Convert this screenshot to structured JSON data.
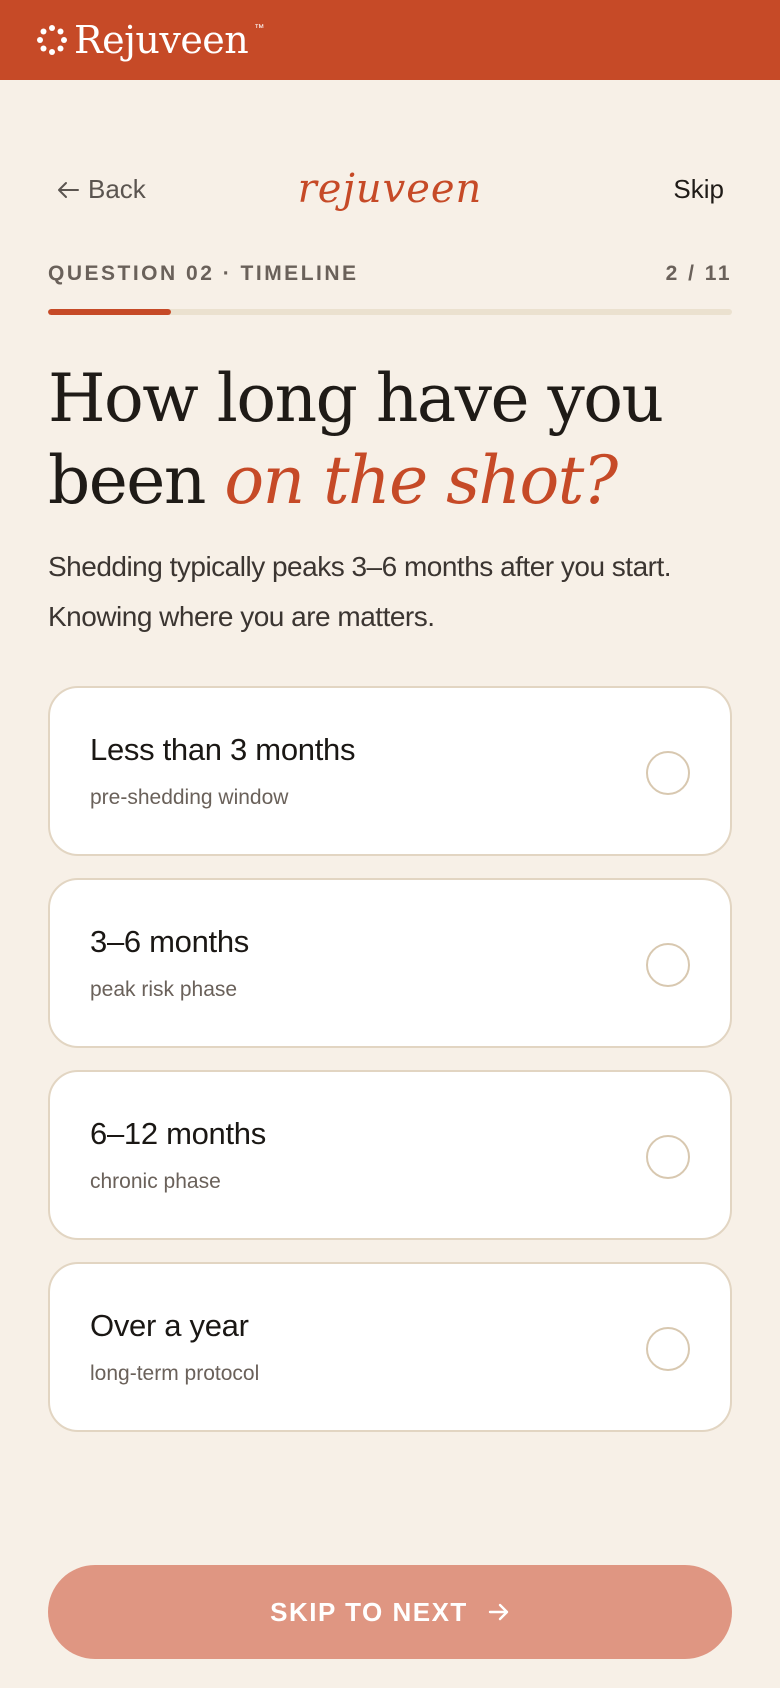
{
  "header": {
    "logo_text": "Rejuveen",
    "logo_tm": "™",
    "brand_color": "#c64a27"
  },
  "nav": {
    "back_label": "Back",
    "brand": "rejuveen",
    "skip_label": "Skip"
  },
  "question": {
    "label": "QUESTION 02 · TIMELINE",
    "counter": "2 / 11",
    "progress_fraction": 0.18,
    "title_line1": "How long have you",
    "title_line2_plain": "been ",
    "title_line2_accent": "on the shot?",
    "description": "Shedding typically peaks 3–6 months after you start. Knowing where you are matters."
  },
  "options": [
    {
      "label": "Less than 3 months",
      "sub": "pre-shedding window",
      "selected": false
    },
    {
      "label": "3–6 months",
      "sub": "peak risk phase",
      "selected": false
    },
    {
      "label": "6–12 months",
      "sub": "chronic phase",
      "selected": false
    },
    {
      "label": "Over a year",
      "sub": "long-term protocol",
      "selected": false
    }
  ],
  "cta": {
    "label": "SKIP TO NEXT",
    "icon": "arrow-right-icon",
    "color": "#df9682"
  }
}
